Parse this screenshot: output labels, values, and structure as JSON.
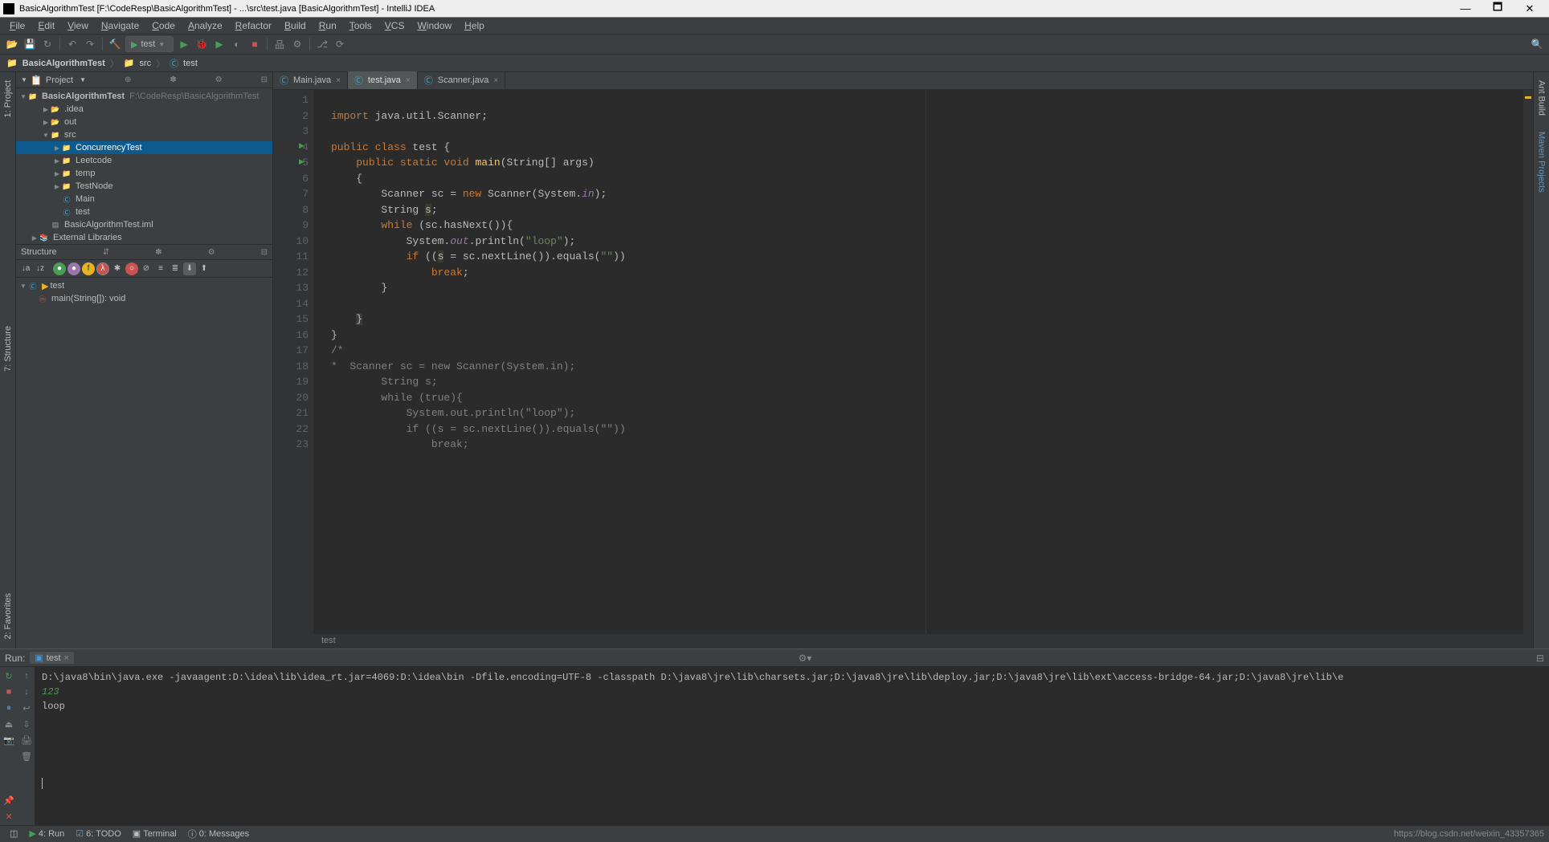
{
  "title": "BasicAlgorithmTest [F:\\CodeResp\\BasicAlgorithmTest] - ...\\src\\test.java [BasicAlgorithmTest] - IntelliJ IDEA",
  "menu": [
    "File",
    "Edit",
    "View",
    "Navigate",
    "Code",
    "Analyze",
    "Refactor",
    "Build",
    "Run",
    "Tools",
    "VCS",
    "Window",
    "Help"
  ],
  "runconfig": "test",
  "breadcrumbs": [
    {
      "label": "BasicAlgorithmTest",
      "icon": "folder"
    },
    {
      "label": "src",
      "icon": "folder-blue"
    },
    {
      "label": "test",
      "icon": "class"
    }
  ],
  "project": {
    "title": "Project",
    "root": {
      "label": "BasicAlgorithmTest",
      "path": "F:\\CodeResp\\BasicAlgorithmTest"
    },
    "items": [
      {
        "label": ".idea",
        "icon": "fold-o",
        "ind": 2,
        "arr": "▶"
      },
      {
        "label": "out",
        "icon": "fold-o",
        "ind": 2,
        "arr": "▶"
      },
      {
        "label": "src",
        "icon": "fold-b",
        "ind": 2,
        "arr": "▼"
      },
      {
        "label": "ConcurrencyTest",
        "icon": "fold-g",
        "ind": 3,
        "arr": "▶",
        "sel": true
      },
      {
        "label": "Leetcode",
        "icon": "fold-g",
        "ind": 3,
        "arr": "▶"
      },
      {
        "label": "temp",
        "icon": "fold-g",
        "ind": 3,
        "arr": "▶"
      },
      {
        "label": "TestNode",
        "icon": "fold-g",
        "ind": 3,
        "arr": "▶"
      },
      {
        "label": "Main",
        "icon": "cls",
        "ind": 3,
        "arr": ""
      },
      {
        "label": "test",
        "icon": "cls",
        "ind": 3,
        "arr": ""
      },
      {
        "label": "BasicAlgorithmTest.iml",
        "icon": "iml",
        "ind": 2,
        "arr": ""
      },
      {
        "label": "External Libraries",
        "icon": "lib",
        "ind": 1,
        "arr": "▶"
      }
    ]
  },
  "structure": {
    "title": "Structure",
    "root": "test",
    "items": [
      {
        "label": "main(String[]): void"
      }
    ]
  },
  "tabs": [
    {
      "label": "Main.java",
      "act": false,
      "icon": "c"
    },
    {
      "label": "test.java",
      "act": true,
      "icon": "c"
    },
    {
      "label": "Scanner.java",
      "act": false,
      "icon": "s"
    }
  ],
  "gutterLines": [
    "1",
    "2",
    "3",
    "4",
    "5",
    "6",
    "7",
    "8",
    "9",
    "10",
    "11",
    "12",
    "13",
    "14",
    "15",
    "16",
    "17",
    "18",
    "19",
    "20",
    "21",
    "22",
    "23"
  ],
  "breadText": "test",
  "run": {
    "title": "Run:",
    "cfg": "test",
    "cmd": "D:\\java8\\bin\\java.exe -javaagent:D:\\idea\\lib\\idea_rt.jar=4069:D:\\idea\\bin -Dfile.encoding=UTF-8 -classpath D:\\java8\\jre\\lib\\charsets.jar;D:\\java8\\jre\\lib\\deploy.jar;D:\\java8\\jre\\lib\\ext\\access-bridge-64.jar;D:\\java8\\jre\\lib\\e",
    "input": "123",
    "out": "loop"
  },
  "status": {
    "run": "4: Run",
    "todo": "6: TODO",
    "term": "Terminal",
    "msg": "0: Messages",
    "url": "https://blog.csdn.net/weixin_43357365"
  },
  "leftTabs": [
    "1: Project",
    "7: Structure"
  ],
  "rightTabs": [
    "Ant Build",
    "Maven Projects"
  ],
  "bottomLeftTabs": [
    "2: Favorites"
  ]
}
